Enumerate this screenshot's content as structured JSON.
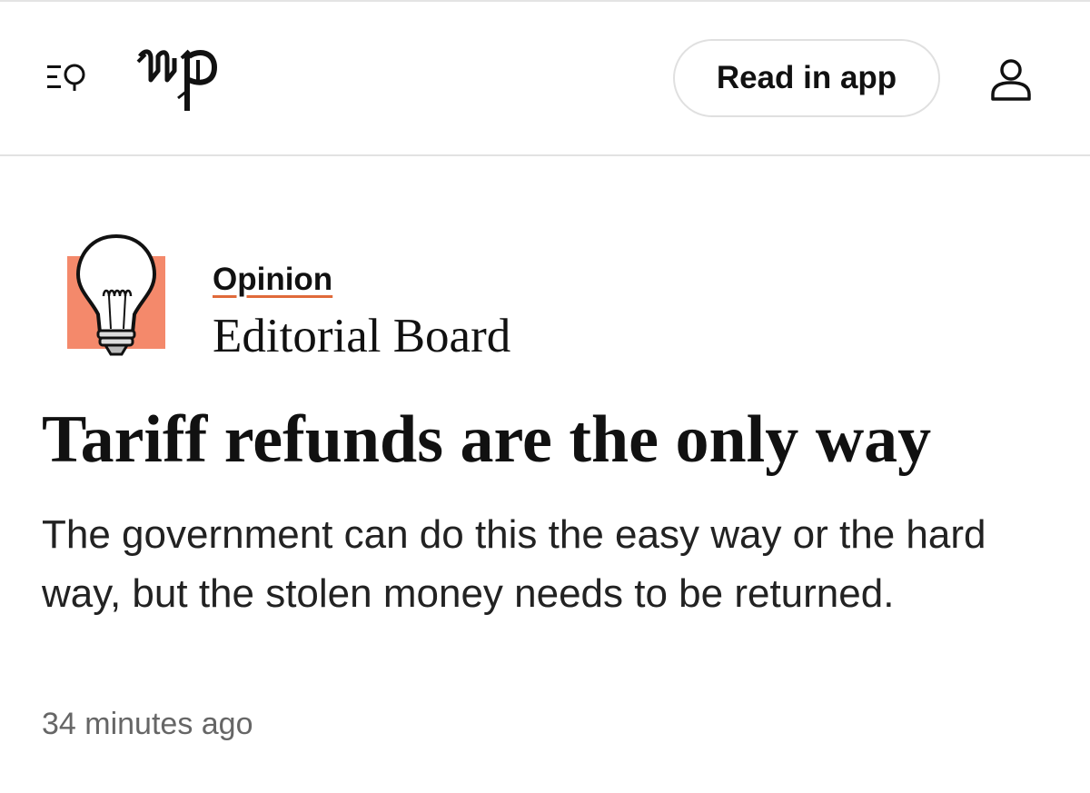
{
  "header": {
    "menu_search_icon": "menu-search-icon",
    "logo_icon": "wp-logo",
    "read_in_app_label": "Read in app",
    "account_icon": "person-icon"
  },
  "article": {
    "section_label": "Opinion",
    "section_illustration_icon": "lightbulb-icon",
    "section_accent_color": "#f4896b",
    "kicker_underline_color": "#e06a3a",
    "author": "Editorial Board",
    "headline": "Tariff refunds are the only way",
    "dek": "The government can do this the easy way or the hard way, but the stolen money needs to be returned.",
    "timestamp": "34 minutes ago"
  }
}
